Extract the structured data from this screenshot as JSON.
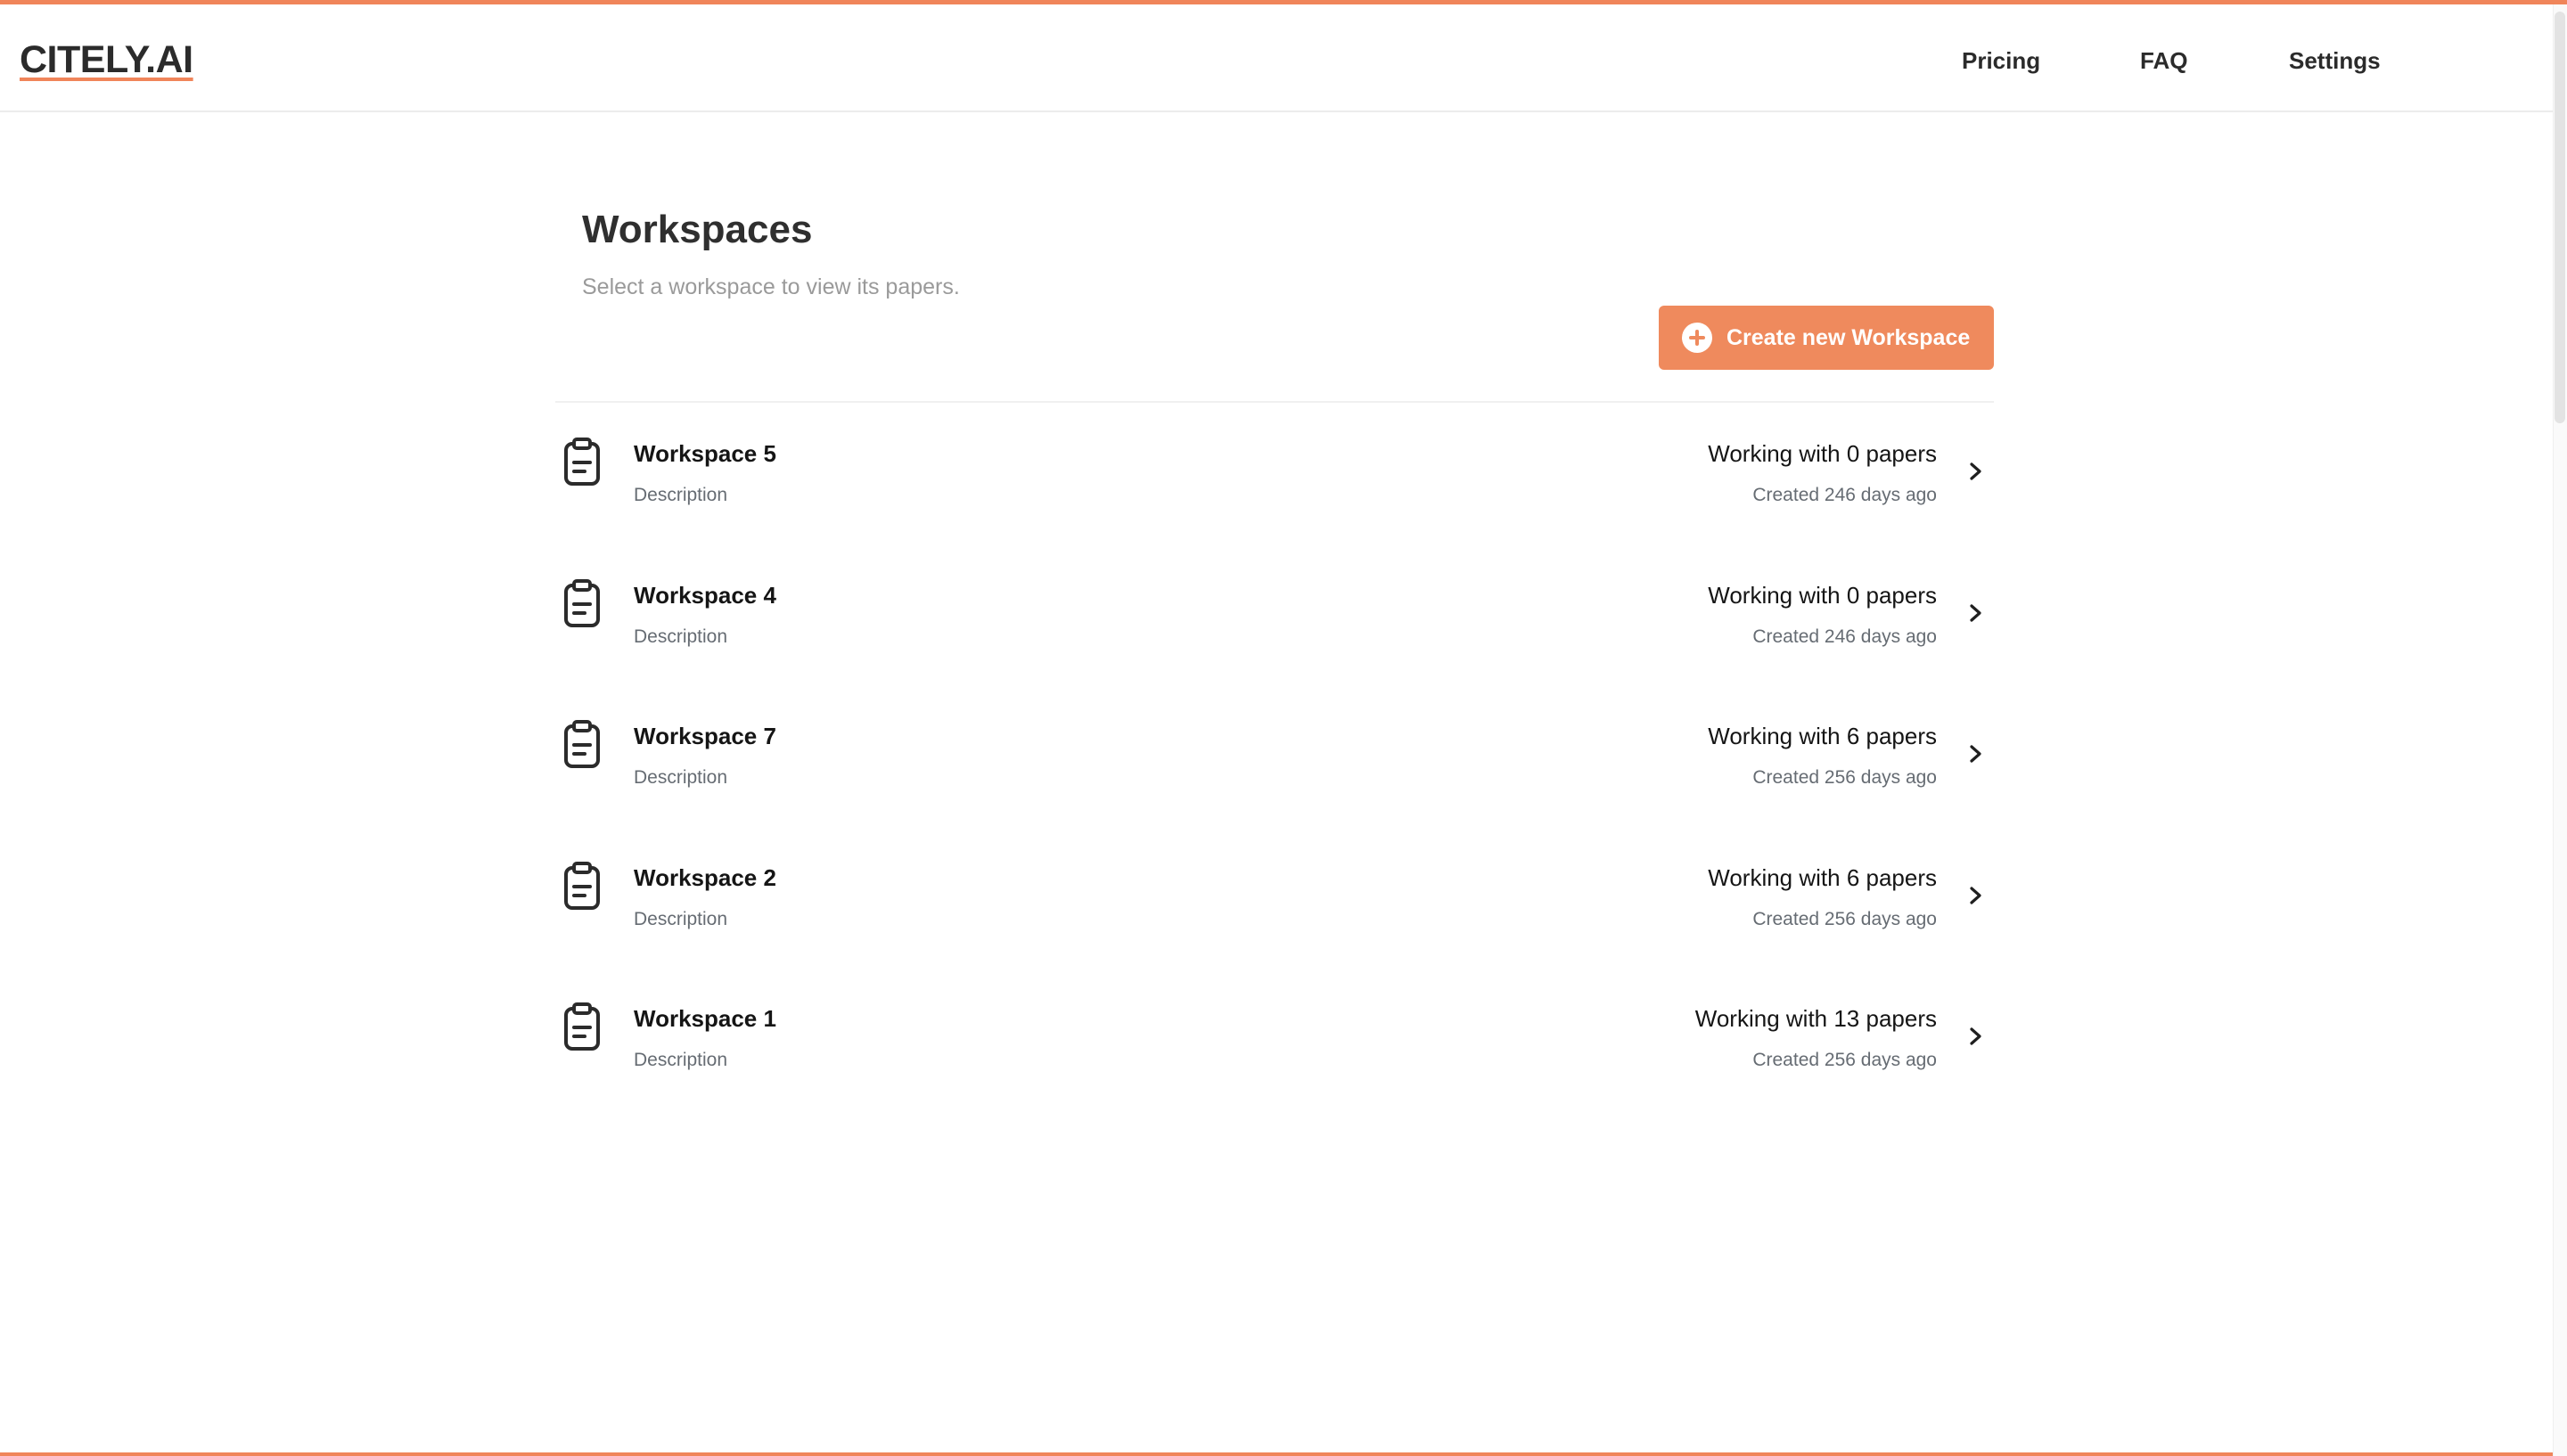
{
  "header": {
    "logo": "CITELY.AI",
    "nav": {
      "pricing": "Pricing",
      "faq": "FAQ",
      "settings": "Settings"
    }
  },
  "main": {
    "title": "Workspaces",
    "subtitle": "Select a workspace to view its papers.",
    "create_button_label": "Create new Workspace",
    "workspaces": [
      {
        "name": "Workspace 5",
        "description": "Description",
        "papers": "Working with 0 papers",
        "created": "Created 246 days ago"
      },
      {
        "name": "Workspace 4",
        "description": "Description",
        "papers": "Working with 0 papers",
        "created": "Created 246 days ago"
      },
      {
        "name": "Workspace 7",
        "description": "Description",
        "papers": "Working with 6 papers",
        "created": "Created 256 days ago"
      },
      {
        "name": "Workspace 2",
        "description": "Description",
        "papers": "Working with 6 papers",
        "created": "Created 256 days ago"
      },
      {
        "name": "Workspace 1",
        "description": "Description",
        "papers": "Working with 13 papers",
        "created": "Created 256 days ago"
      }
    ]
  },
  "colors": {
    "accent": "#f0855a",
    "button": "#ef8a5d",
    "text": "#1f1f1f",
    "muted": "#666c73"
  },
  "icons": {
    "workspace": "clipboard-icon",
    "open": "chevron-right-icon",
    "create": "plus-circle-icon"
  }
}
